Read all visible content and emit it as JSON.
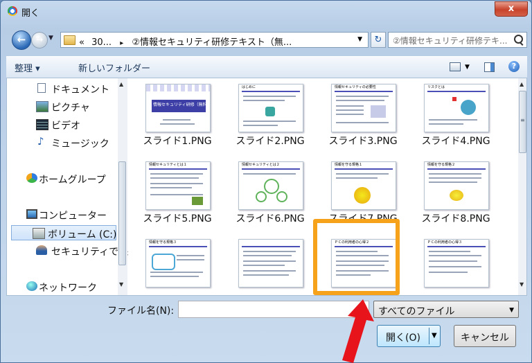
{
  "window": {
    "title": "開く",
    "close_glyph": "x"
  },
  "nav": {
    "back_glyph": "←",
    "forward_glyph": "→",
    "address": {
      "prefix": "«",
      "segments": [
        "30...",
        "②情報セキュリティ研修テキスト（無..."
      ],
      "sep": "▸"
    },
    "refresh_glyph": "↻",
    "search_placeholder": "②情報セキュリティ研修テキ..."
  },
  "commandbar": {
    "organize": "整理 ▾",
    "new_folder": "新しいフォルダー"
  },
  "sidebar": {
    "items": [
      {
        "label": "ドキュメント",
        "icon": "document-icon"
      },
      {
        "label": "ピクチャ",
        "icon": "pictures-icon"
      },
      {
        "label": "ビデオ",
        "icon": "video-icon"
      },
      {
        "label": "ミュージック",
        "icon": "music-icon"
      },
      {
        "label": "ホームグループ",
        "icon": "homegroup-icon"
      },
      {
        "label": "コンピューター",
        "icon": "computer-icon"
      },
      {
        "label": "ボリューム (C:)",
        "icon": "drive-icon",
        "selected": true
      },
      {
        "label": "セキュリティで保",
        "icon": "user-icon"
      },
      {
        "label": "ネットワーク",
        "icon": "network-icon"
      }
    ]
  },
  "files": [
    {
      "name": "スライド1.PNG",
      "thumb_title": "情報セキュリティ研修（無料トライアル版）"
    },
    {
      "name": "スライド2.PNG",
      "thumb_title": "はじめに"
    },
    {
      "name": "スライド3.PNG",
      "thumb_title": "情報セキュリティの必要性"
    },
    {
      "name": "スライド4.PNG",
      "thumb_title": "リスクとは"
    },
    {
      "name": "スライド5.PNG",
      "thumb_title": "情報セキュリティとは１"
    },
    {
      "name": "スライド6.PNG",
      "thumb_title": "情報セキュリティとは２"
    },
    {
      "name": "スライド7.PNG",
      "thumb_title": "情報を守る規格１"
    },
    {
      "name": "スライド8.PNG",
      "thumb_title": "情報を守る規格２"
    },
    {
      "name": "",
      "thumb_title": "情報を守る規格３"
    },
    {
      "name": "",
      "thumb_title": ""
    },
    {
      "name": "",
      "thumb_title": "ＰＣの利用者の心得２"
    },
    {
      "name": "",
      "thumb_title": "ＰＣの利用者の心得３"
    }
  ],
  "footer": {
    "filename_label": "ファイル名(N):",
    "filename_value": "",
    "filetype": "すべてのファイル",
    "open_label": "開く(O)",
    "cancel_label": "キャンセル"
  },
  "colors": {
    "highlight": "#f7a21b",
    "arrow": "#e8141b",
    "accent": "#4a4fb6"
  }
}
